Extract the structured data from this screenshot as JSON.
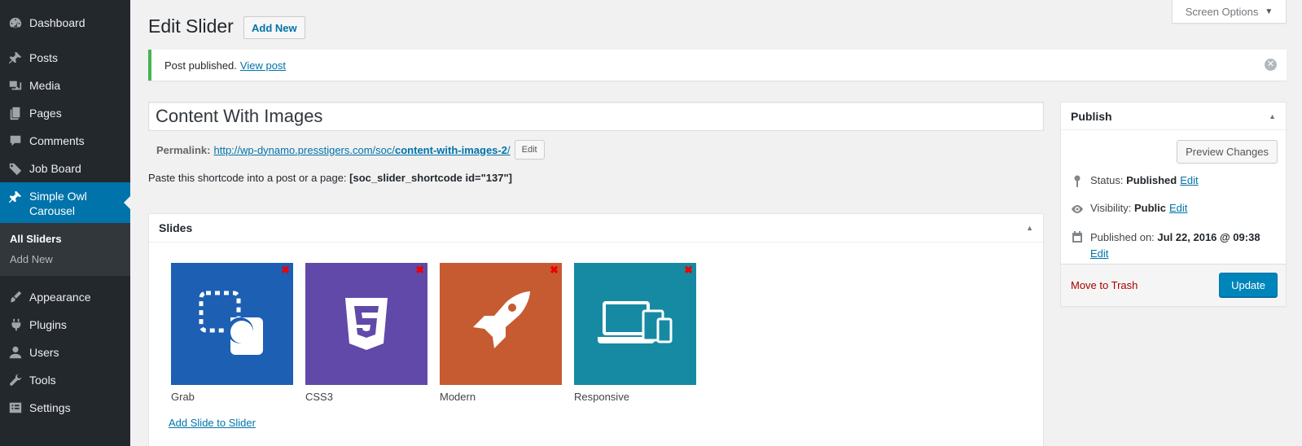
{
  "sidebar": {
    "items": [
      {
        "label": "Dashboard",
        "icon": "dashboard-icon"
      },
      {
        "label": "Posts",
        "icon": "pin-icon"
      },
      {
        "label": "Media",
        "icon": "media-icon"
      },
      {
        "label": "Pages",
        "icon": "pages-icon"
      },
      {
        "label": "Comments",
        "icon": "comment-icon"
      },
      {
        "label": "Job Board",
        "icon": "tag-icon"
      },
      {
        "label": "Simple Owl Carousel",
        "icon": "pin-icon"
      },
      {
        "label": "Appearance",
        "icon": "brush-icon"
      },
      {
        "label": "Plugins",
        "icon": "plugin-icon"
      },
      {
        "label": "Users",
        "icon": "user-icon"
      },
      {
        "label": "Tools",
        "icon": "wrench-icon"
      },
      {
        "label": "Settings",
        "icon": "settings-icon"
      }
    ],
    "submenu": [
      "All Sliders",
      "Add New"
    ]
  },
  "screen_options": "Screen Options",
  "header": {
    "title": "Edit Slider",
    "add_new": "Add New"
  },
  "notice": {
    "text": "Post published.",
    "link": "View post"
  },
  "post_title": "Content With Images",
  "permalink": {
    "label": "Permalink:",
    "base": "http://wp-dynamo.presstigers.com/soc/",
    "slug": "content-with-images-2",
    "trail": "/",
    "edit": "Edit"
  },
  "shortcode": {
    "text": "Paste this shortcode into a post or a page:",
    "code": "[soc_slider_shortcode id=\"137\"]"
  },
  "slides_box": {
    "title": "Slides",
    "slides": [
      {
        "caption": "Grab",
        "color": "#1c5fb3",
        "icon": "grab-icon"
      },
      {
        "caption": "CSS3",
        "color": "#6149a9",
        "icon": "css3-icon"
      },
      {
        "caption": "Modern",
        "color": "#c65a31",
        "icon": "rocket-icon"
      },
      {
        "caption": "Responsive",
        "color": "#168aa3",
        "icon": "devices-icon"
      }
    ],
    "add_link": "Add Slide to Slider"
  },
  "publish_box": {
    "title": "Publish",
    "preview": "Preview Changes",
    "status_label": "Status:",
    "status_value": "Published",
    "visibility_label": "Visibility:",
    "visibility_value": "Public",
    "published_label": "Published on:",
    "published_value": "Jul 22, 2016 @ 09:38",
    "edit": "Edit",
    "trash": "Move to Trash",
    "update": "Update"
  }
}
